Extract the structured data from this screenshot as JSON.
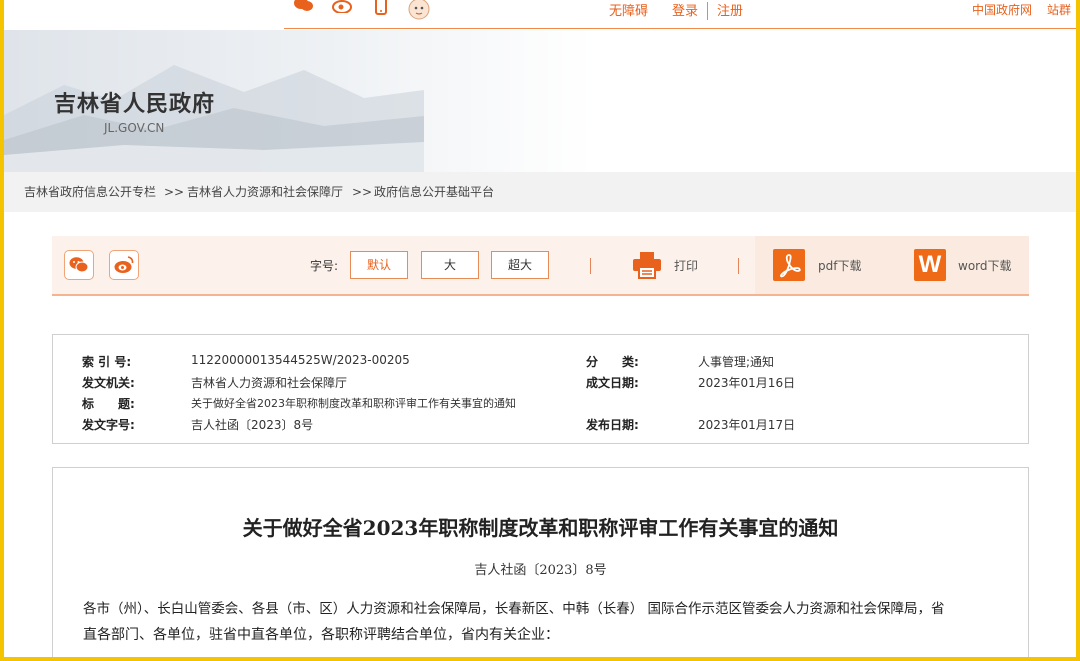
{
  "topbar": {
    "accessibility": "无障碍",
    "login": "登录",
    "register": "注册",
    "gov_portal": "中国政府网",
    "site_group": "站群"
  },
  "header": {
    "site_title": "吉林省人民政府",
    "site_domain": "JL.GOV.CN"
  },
  "breadcrumb": {
    "items": [
      "吉林省政府信息公开专栏",
      "吉林省人力资源和社会保障厅",
      "政府信息公开基础平台"
    ],
    "separator": ">>"
  },
  "toolbar": {
    "font_size_label": "字号:",
    "font_sizes": [
      "默认",
      "大",
      "超大"
    ],
    "print_label": "打印",
    "pdf_label": "pdf下载",
    "word_label": "word下载",
    "word_badge": "W"
  },
  "meta": {
    "index_no_label": "索 引 号:",
    "index_no": "11220000013544525W/2023-00205",
    "category_label": "分　　类:",
    "category": "人事管理;通知",
    "issuer_label": "发文机关:",
    "issuer": "吉林省人力资源和社会保障厅",
    "created_label": "成文日期:",
    "created": "2023年01月16日",
    "title_label": "标　　题:",
    "title": "关于做好全省2023年职称制度改革和职称评审工作有关事宜的通知",
    "doc_no_label": "发文字号:",
    "doc_no": "吉人社函〔2023〕8号",
    "published_label": "发布日期:",
    "published": "2023年01月17日"
  },
  "document": {
    "title": "关于做好全省2023年职称制度改革和职称评审工作有关事宜的通知",
    "doc_number": "吉人社函〔2023〕8号",
    "body_line1": "各市（州）、长白山管委会、各县（市、区）人力资源和社会保障局，长春新区、中韩（长春） 国际合作示范区管委会人力资源和社会保障局，省",
    "body_line2": "直各部门、各单位，驻省中直各单位，各职称评聘结合单位，省内有关企业："
  },
  "colors": {
    "accent": "#e8611d",
    "frame": "#f5c400"
  }
}
